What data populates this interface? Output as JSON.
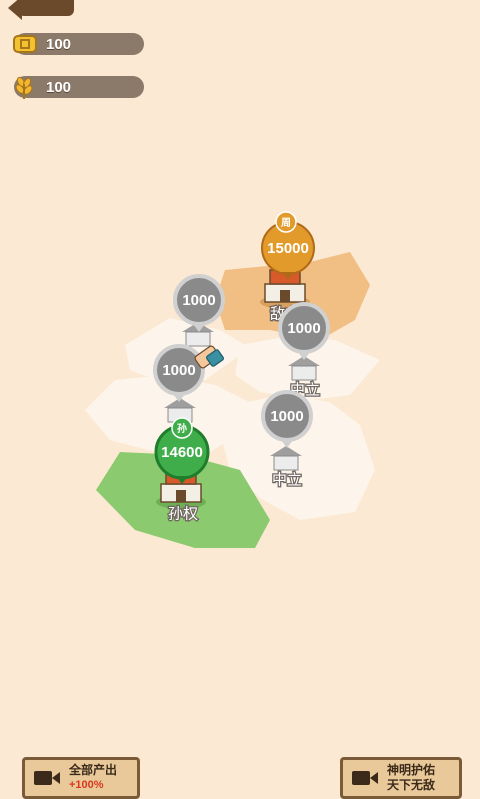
{
  "resources": {
    "coins": {
      "value": "100",
      "icon": "coin-icon"
    },
    "wheat": {
      "value": "100",
      "icon": "wheat-icon"
    }
  },
  "cities": [
    {
      "id": "enemy",
      "troops": "15000",
      "badge": "周",
      "label": "敌方",
      "owner": "orange"
    },
    {
      "id": "neutral-a",
      "troops": "1000",
      "label": "",
      "owner": "neutral"
    },
    {
      "id": "neutral-b",
      "troops": "1000",
      "label": "中立",
      "owner": "neutral"
    },
    {
      "id": "neutral-c",
      "troops": "1000",
      "label": "",
      "owner": "neutral"
    },
    {
      "id": "neutral-d",
      "troops": "1000",
      "label": "中立",
      "owner": "neutral"
    },
    {
      "id": "player",
      "troops": "14600",
      "badge": "孙",
      "label": "孙权",
      "owner": "green"
    }
  ],
  "buttons": {
    "produce": {
      "line1": "全部产出",
      "line2": "+100%",
      "icon": "video-icon"
    },
    "protect": {
      "line1": "神明护佑",
      "line2": "天下无敌",
      "icon": "video-icon"
    }
  },
  "colors": {
    "background": "#fbe9d3",
    "player": "#5cb85c",
    "enemy": "#e29a2b",
    "neutral": "#8a8a8a"
  }
}
